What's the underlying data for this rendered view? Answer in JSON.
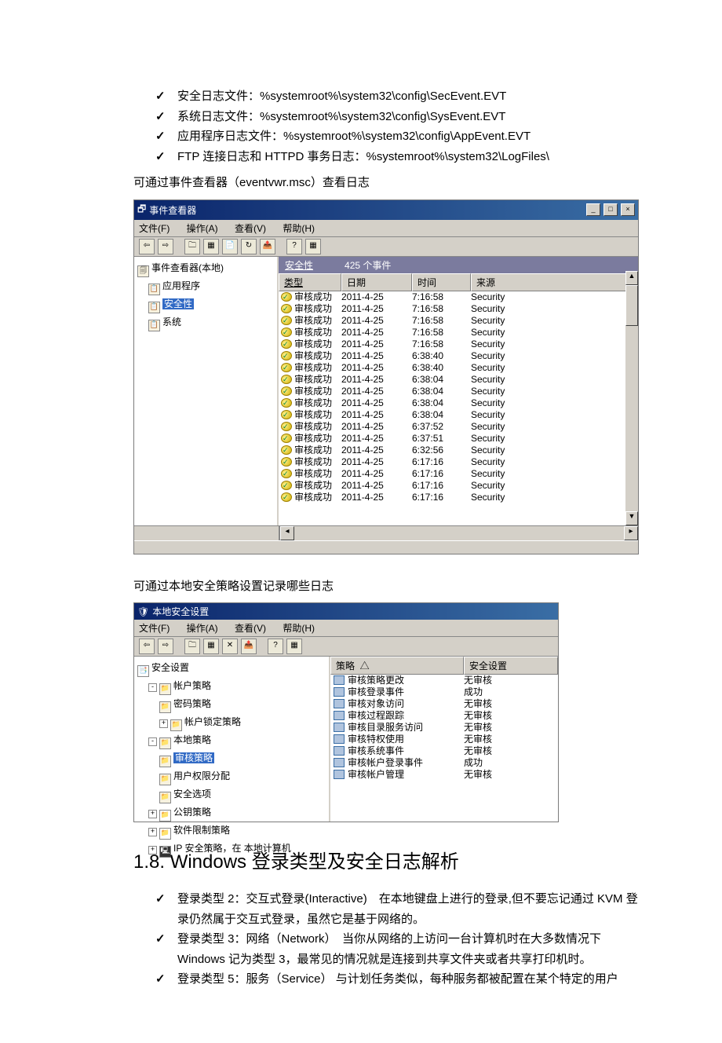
{
  "bullets1": {
    "b1": "安全日志文件：%systemroot%\\system32\\config\\SecEvent.EVT",
    "b2": "系统日志文件：%systemroot%\\system32\\config\\SysEvent.EVT",
    "b3": "应用程序日志文件：%systemroot%\\system32\\config\\AppEvent.EVT",
    "b4": "FTP 连接日志和 HTTPD 事务日志：%systemroot%\\system32\\LogFiles\\"
  },
  "note1": "可通过事件查看器（eventvwr.msc）查看日志",
  "eventViewer": {
    "title": "事件查看器",
    "menu": {
      "file": "文件(F)",
      "action": "操作(A)",
      "view": "查看(V)",
      "help": "帮助(H)"
    },
    "tree": {
      "root": "事件查看器(本地)",
      "app": "应用程序",
      "sec": "安全性",
      "sys": "系统"
    },
    "header": {
      "name": "安全性",
      "count": "425 个事件"
    },
    "cols": {
      "type": "类型",
      "date": "日期",
      "time": "时间",
      "source": "来源"
    },
    "rows": [
      {
        "t": "审核成功",
        "d": "2011-4-25",
        "tm": "7:16:58",
        "s": "Security"
      },
      {
        "t": "审核成功",
        "d": "2011-4-25",
        "tm": "7:16:58",
        "s": "Security"
      },
      {
        "t": "审核成功",
        "d": "2011-4-25",
        "tm": "7:16:58",
        "s": "Security"
      },
      {
        "t": "审核成功",
        "d": "2011-4-25",
        "tm": "7:16:58",
        "s": "Security"
      },
      {
        "t": "审核成功",
        "d": "2011-4-25",
        "tm": "7:16:58",
        "s": "Security"
      },
      {
        "t": "审核成功",
        "d": "2011-4-25",
        "tm": "6:38:40",
        "s": "Security"
      },
      {
        "t": "审核成功",
        "d": "2011-4-25",
        "tm": "6:38:40",
        "s": "Security"
      },
      {
        "t": "审核成功",
        "d": "2011-4-25",
        "tm": "6:38:04",
        "s": "Security"
      },
      {
        "t": "审核成功",
        "d": "2011-4-25",
        "tm": "6:38:04",
        "s": "Security"
      },
      {
        "t": "审核成功",
        "d": "2011-4-25",
        "tm": "6:38:04",
        "s": "Security"
      },
      {
        "t": "审核成功",
        "d": "2011-4-25",
        "tm": "6:38:04",
        "s": "Security"
      },
      {
        "t": "审核成功",
        "d": "2011-4-25",
        "tm": "6:37:52",
        "s": "Security"
      },
      {
        "t": "审核成功",
        "d": "2011-4-25",
        "tm": "6:37:51",
        "s": "Security"
      },
      {
        "t": "审核成功",
        "d": "2011-4-25",
        "tm": "6:32:56",
        "s": "Security"
      },
      {
        "t": "审核成功",
        "d": "2011-4-25",
        "tm": "6:17:16",
        "s": "Security"
      },
      {
        "t": "审核成功",
        "d": "2011-4-25",
        "tm": "6:17:16",
        "s": "Security"
      },
      {
        "t": "审核成功",
        "d": "2011-4-25",
        "tm": "6:17:16",
        "s": "Security"
      },
      {
        "t": "审核成功",
        "d": "2011-4-25",
        "tm": "6:17:16",
        "s": "Security"
      }
    ]
  },
  "note2": "可通过本地安全策略设置记录哪些日志",
  "localSec": {
    "title": "本地安全设置",
    "menu": {
      "file": "文件(F)",
      "action": "操作(A)",
      "view": "查看(V)",
      "help": "帮助(H)"
    },
    "tree": {
      "root": "安全设置",
      "acct": "帐户策略",
      "pwd": "密码策略",
      "lock": "帐户锁定策略",
      "local": "本地策略",
      "audit": "审核策略",
      "rights": "用户权限分配",
      "opts": "安全选项",
      "pub": "公钥策略",
      "soft": "软件限制策略",
      "ip": "IP 安全策略，在 本地计算机"
    },
    "cols": {
      "policy": "策略",
      "setting": "安全设置"
    },
    "rows": [
      {
        "p": "审核策略更改",
        "s": "无审核"
      },
      {
        "p": "审核登录事件",
        "s": "成功"
      },
      {
        "p": "审核对象访问",
        "s": "无审核"
      },
      {
        "p": "审核过程跟踪",
        "s": "无审核"
      },
      {
        "p": "审核目录服务访问",
        "s": "无审核"
      },
      {
        "p": "审核特权使用",
        "s": "无审核"
      },
      {
        "p": "审核系统事件",
        "s": "无审核"
      },
      {
        "p": "审核帐户登录事件",
        "s": "成功"
      },
      {
        "p": "审核帐户管理",
        "s": "无审核"
      }
    ]
  },
  "heading": "1.8. Windows 登录类型及安全日志解析",
  "bullets2": {
    "b1": "登录类型 2：交互式登录(Interactive)　在本地键盘上进行的登录,但不要忘记通过 KVM 登录仍然属于交互式登录，虽然它是基于网络的。",
    "b2": "登录类型 3：网络（Network）　当你从网络的上访问一台计算机时在大多数情况下Windows 记为类型 3，最常见的情况就是连接到共享文件夹或者共享打印机时。",
    "b3": "登录类型 5：服务（Service） 与计划任务类似，每种服务都被配置在某个特定的用户"
  }
}
